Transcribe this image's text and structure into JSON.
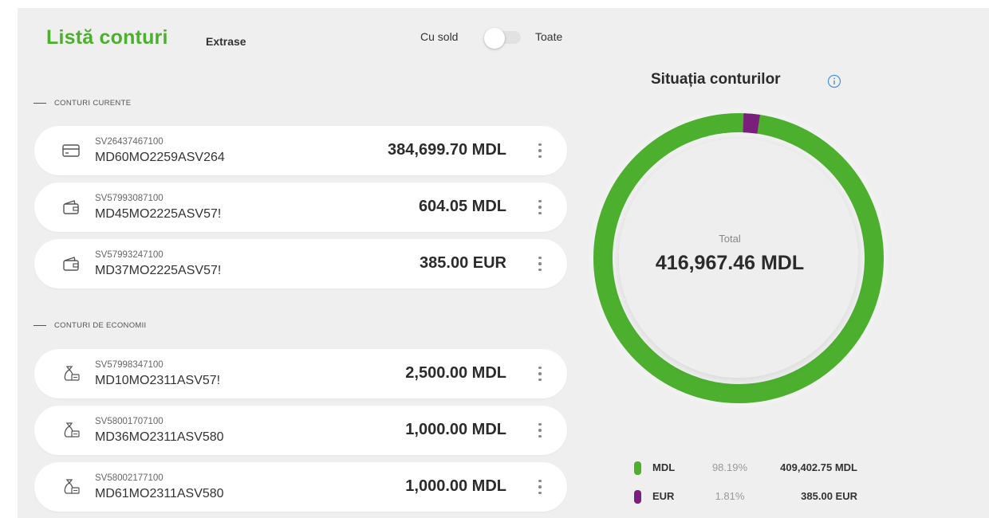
{
  "header": {
    "title": "Listă conturi",
    "tab_extrase": "Extrase",
    "filter_left": "Cu sold",
    "filter_right": "Toate"
  },
  "sections": {
    "current": "CONTURI CURENTE",
    "savings": "CONTURI DE ECONOMII"
  },
  "accounts": [
    {
      "id": "SV26437467100",
      "iban": "MD60MO2259ASV264",
      "amount": "384,699.70 MDL",
      "icon": "credit-card-icon"
    },
    {
      "id": "SV57993087100",
      "iban": "MD45MO2225ASV57!",
      "amount": "604.05 MDL",
      "icon": "wallet-icon"
    },
    {
      "id": "SV57993247100",
      "iban": "MD37MO2225ASV57!",
      "amount": "385.00 EUR",
      "icon": "wallet-icon"
    },
    {
      "id": "SV57998347100",
      "iban": "MD10MO2311ASV57!",
      "amount": "2,500.00 MDL",
      "icon": "money-bag-icon"
    },
    {
      "id": "SV58001707100",
      "iban": "MD36MO2311ASV580",
      "amount": "1,000.00 MDL",
      "icon": "money-bag-icon"
    },
    {
      "id": "SV58002177100",
      "iban": "MD61MO2311ASV580",
      "amount": "1,000.00 MDL",
      "icon": "money-bag-icon"
    }
  ],
  "summary": {
    "title": "Situația conturilor",
    "total_label": "Total",
    "total_value": "416,967.46 MDL"
  },
  "legend": [
    {
      "currency": "MDL",
      "percent": "98.19%",
      "amount": "409,402.75 MDL",
      "color": "#4caf2e"
    },
    {
      "currency": "EUR",
      "percent": "1.81%",
      "amount": "385.00 EUR",
      "color": "#7b1f7d"
    }
  ],
  "colors": {
    "brand_green": "#4caf2e",
    "eur_purple": "#7b1f7d"
  }
}
